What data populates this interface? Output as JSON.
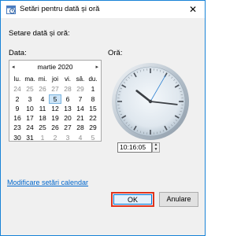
{
  "window": {
    "title": "Setări pentru dată și oră",
    "close_glyph": "✕",
    "icon": "date-time-icon"
  },
  "caption": "Setare dată și oră:",
  "date_label": "Data:",
  "time_label": "Oră:",
  "calendar": {
    "month_year": "martie 2020",
    "prev_glyph": "◂",
    "next_glyph": "▸",
    "weekdays": [
      "lu.",
      "ma.",
      "mi.",
      "joi",
      "vi.",
      "sâ.",
      "du."
    ],
    "weeks": [
      [
        "24",
        "25",
        "26",
        "27",
        "28",
        "29",
        "1"
      ],
      [
        "2",
        "3",
        "4",
        "5",
        "6",
        "7",
        "8"
      ],
      [
        "9",
        "10",
        "11",
        "12",
        "13",
        "14",
        "15"
      ],
      [
        "16",
        "17",
        "18",
        "19",
        "20",
        "21",
        "22"
      ],
      [
        "23",
        "24",
        "25",
        "26",
        "27",
        "28",
        "29"
      ],
      [
        "30",
        "31",
        "1",
        "2",
        "3",
        "4",
        "5"
      ]
    ],
    "muted": [
      [
        0,
        0
      ],
      [
        0,
        1
      ],
      [
        0,
        2
      ],
      [
        0,
        3
      ],
      [
        0,
        4
      ],
      [
        0,
        5
      ],
      [
        5,
        2
      ],
      [
        5,
        3
      ],
      [
        5,
        4
      ],
      [
        5,
        5
      ],
      [
        5,
        6
      ]
    ],
    "selected": [
      1,
      3
    ]
  },
  "clock": {
    "hours": 10,
    "minutes": 16,
    "seconds": 5
  },
  "time_value": "10:16:05",
  "spinner": {
    "up_glyph": "▲",
    "down_glyph": "▼"
  },
  "calendar_link": "Modificare setări calendar",
  "buttons": {
    "ok": "OK",
    "cancel": "Anulare"
  },
  "colors": {
    "accent": "#0078d7",
    "highlight_outline": "#e0341c",
    "link": "#0066cc"
  }
}
